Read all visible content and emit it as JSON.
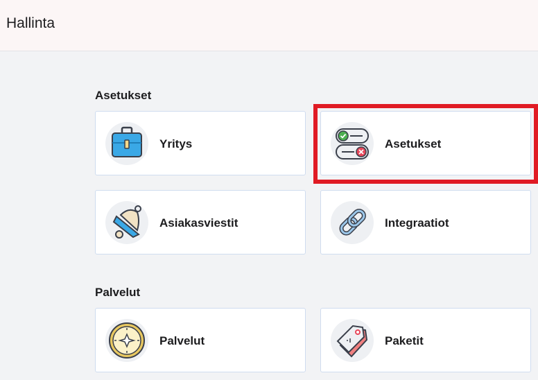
{
  "header": {
    "title": "Hallinta"
  },
  "sections": [
    {
      "title": "Asetukset",
      "cards": [
        {
          "label": "Yritys",
          "icon": "briefcase-icon"
        },
        {
          "label": "Asetukset",
          "icon": "toggle-switches-icon"
        },
        {
          "label": "Asiakasviestit",
          "icon": "bell-icon"
        },
        {
          "label": "Integraatiot",
          "icon": "chain-link-icon"
        }
      ]
    },
    {
      "title": "Palvelut",
      "cards": [
        {
          "label": "Palvelut",
          "icon": "compass-icon"
        },
        {
          "label": "Paketit",
          "icon": "price-tags-icon"
        }
      ]
    }
  ],
  "colors": {
    "highlight": "#e01b24",
    "card_border": "#cfdcef",
    "header_bg": "#fcf6f6"
  }
}
